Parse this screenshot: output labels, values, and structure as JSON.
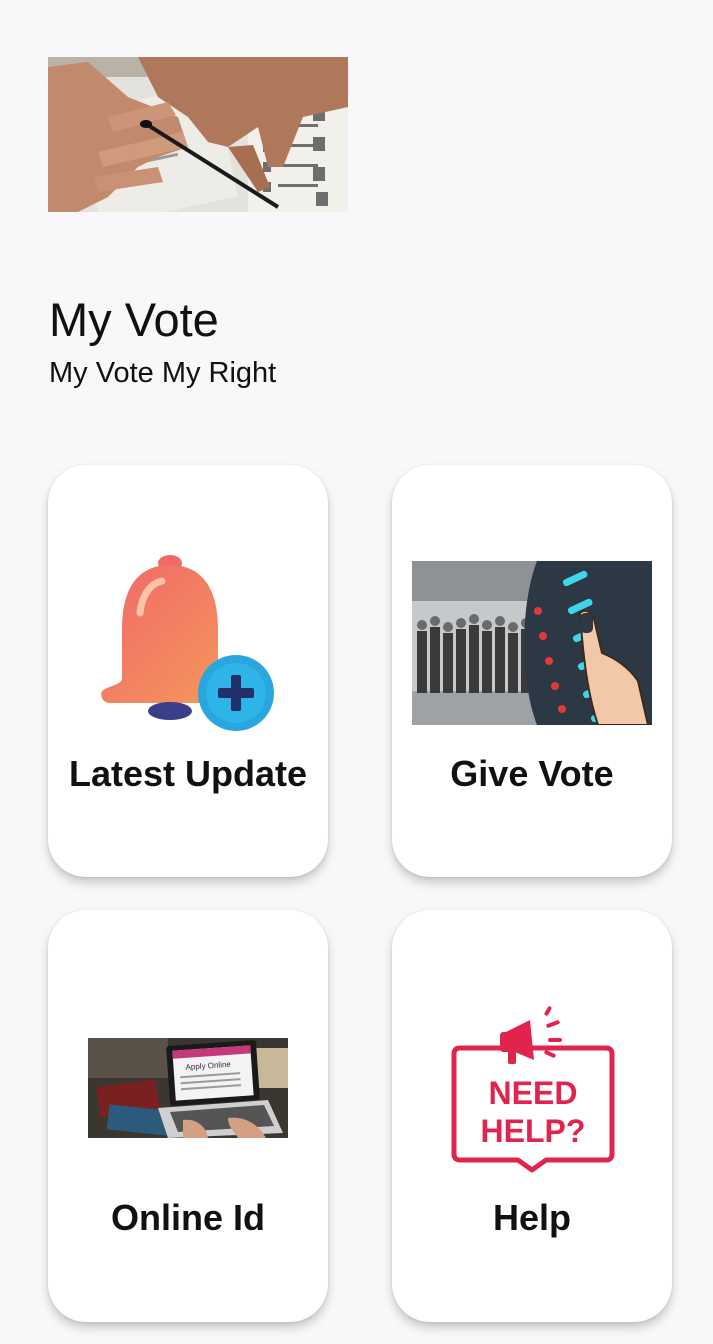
{
  "header": {
    "title": "My Vote",
    "subtitle": "My Vote My Right"
  },
  "banner": {
    "icon": "voter-ink-finger-image"
  },
  "cards": [
    {
      "label": "Latest Update",
      "icon": "bell-plus-icon"
    },
    {
      "label": "Give Vote",
      "icon": "voting-queue-image"
    },
    {
      "label": "Online Id",
      "icon": "laptop-apply-online-image"
    },
    {
      "label": "Help",
      "icon": "need-help-icon"
    }
  ],
  "help_badge": {
    "line1": "NEED",
    "line2": "HELP?"
  },
  "laptop_screen_text": "Apply Online",
  "colors": {
    "background": "#f8f8fa",
    "card": "#ffffff",
    "bell": "#f08060",
    "plus_badge": "#29a8e0",
    "help_red": "#e0244e",
    "evm_dark": "#2c3844",
    "evm_cyan": "#3fd6e8"
  }
}
